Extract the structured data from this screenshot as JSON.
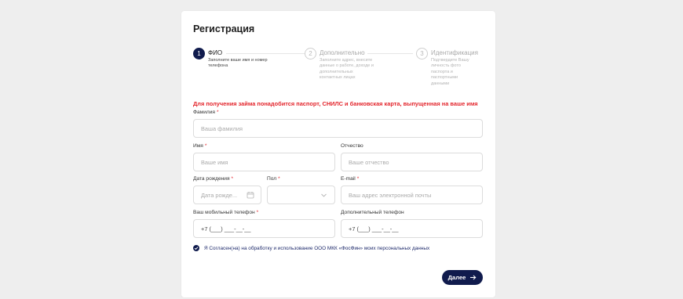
{
  "page": {
    "title": "Регистрация",
    "notice": "Для получения займа понадобится паспорт, СНИЛС и банковская карта, выпущенная на ваше имя"
  },
  "steps": [
    {
      "number": "1",
      "label": "ФИО",
      "description": "Заполните ваше имя и номер телефона"
    },
    {
      "number": "2",
      "label": "Дополнительно",
      "description": "Заполните адрес, внесите данные о работе, доходе и дополнительных контактных лицах"
    },
    {
      "number": "3",
      "label": "Идентификация",
      "description": "Подтвердите Вашу личность фото паспорта и паспортными данными"
    }
  ],
  "form": {
    "last_name": {
      "label": "Фамилия",
      "required": "*",
      "placeholder": "Ваша фамилия"
    },
    "first_name": {
      "label": "Имя",
      "required": "*",
      "placeholder": "Ваше имя"
    },
    "patronymic": {
      "label": "Отчество",
      "placeholder": "Ваше отчество"
    },
    "birth_date": {
      "label": "Дата рождения",
      "required": "*",
      "placeholder": "Дата рожде..."
    },
    "gender": {
      "label": "Пол",
      "required": "*",
      "value": ""
    },
    "email": {
      "label": "E-mail",
      "required": "*",
      "placeholder": "Ваш адрес электронной почты"
    },
    "mobile_phone": {
      "label": "Ваш мобильный телефон",
      "required": "*",
      "value": "+7 (___) ___-__-__"
    },
    "extra_phone": {
      "label": "Дополнительный телефон",
      "value": "+7 (___) ___-__-__"
    }
  },
  "consent": {
    "checked": true,
    "text": "Я Согласен(на) на обработку и использование ООО МКК «ФосФин» моих персональных данных"
  },
  "next_button": {
    "label": "Далее",
    "icon": "arrow-right-icon"
  },
  "colors": {
    "primary": "#101b4d",
    "accent_red": "#e3242b",
    "background": "#eeeeee"
  }
}
